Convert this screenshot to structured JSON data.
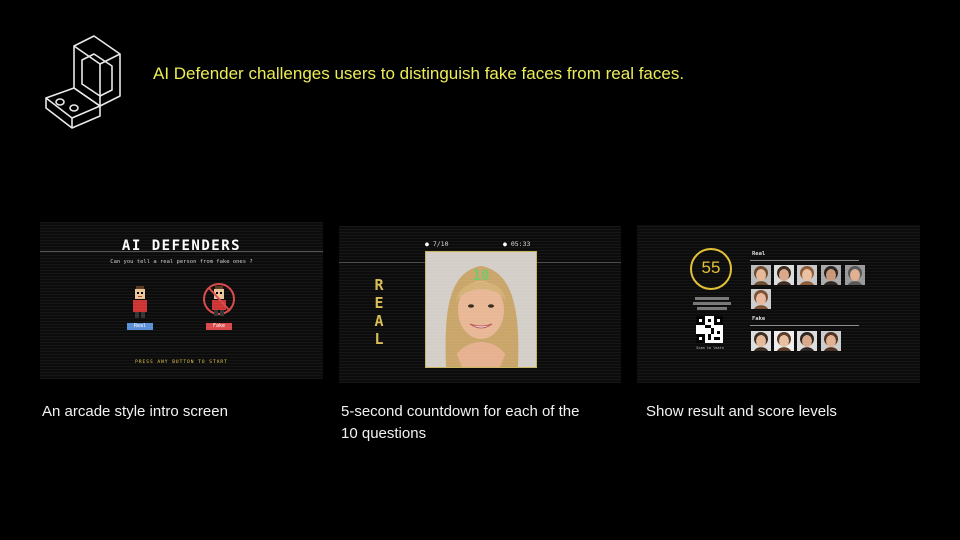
{
  "headline": "AI Defender challenges users to distinguish fake faces from real faces.",
  "intro_screen": {
    "title": "AI DEFENDERS",
    "subtitle": "Can you tell a real person from fake ones ?",
    "real_button": "Real",
    "fake_button": "Fake",
    "prompt": "PRESS ANY BUTTON TO START"
  },
  "countdown_screen": {
    "progress": "7/10",
    "clock": "05:33",
    "timer": "10",
    "label": [
      "R",
      "E",
      "A",
      "L"
    ]
  },
  "result_screen": {
    "score": "55",
    "real_label": "Real",
    "fake_label": "Fake",
    "qr_caption": "Scan to learn"
  },
  "captions": {
    "intro": "An arcade style intro screen",
    "countdown": [
      "5-second countdown for each of the",
      "10 questions"
    ],
    "result": "Show result and score levels"
  },
  "colors": {
    "headline": "#ecec57",
    "accent_gold": "#e2c134",
    "real_blue": "#5a8fd8",
    "fake_red": "#d9484a"
  }
}
